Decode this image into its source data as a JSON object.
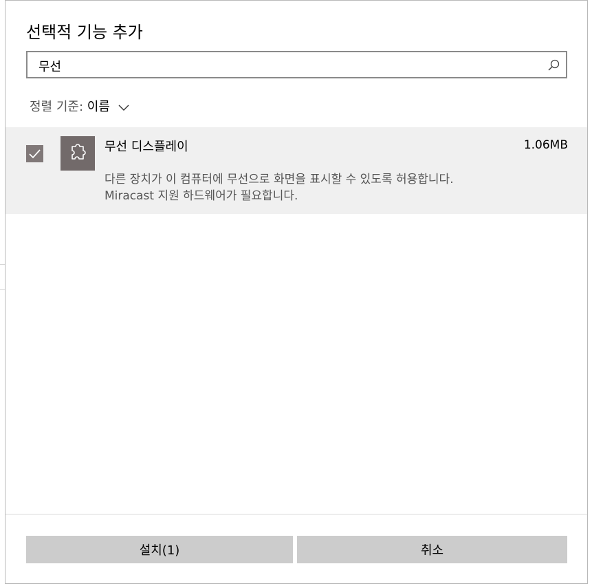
{
  "dialog": {
    "title": "선택적 기능 추가",
    "search": {
      "value": "무선",
      "icon": "search-icon"
    },
    "sort": {
      "label": "정렬 기준:",
      "value": "이름"
    },
    "features": [
      {
        "checked": true,
        "name": "무선 디스플레이",
        "size": "1.06MB",
        "description_line1": "다른 장치가 이 컴퓨터에 무선으로 화면을 표시할 수 있도록 허용합니다.",
        "description_line2": "Miracast 지원 하드웨어가 필요합니다.",
        "icon": "puzzle-icon"
      }
    ],
    "buttons": {
      "install": "설치(1)",
      "cancel": "취소"
    }
  },
  "colors": {
    "item_bg": "#f0f0f0",
    "checkbox": "#807878",
    "package_icon_bg": "#726a6a",
    "button_bg": "#cccccc"
  }
}
